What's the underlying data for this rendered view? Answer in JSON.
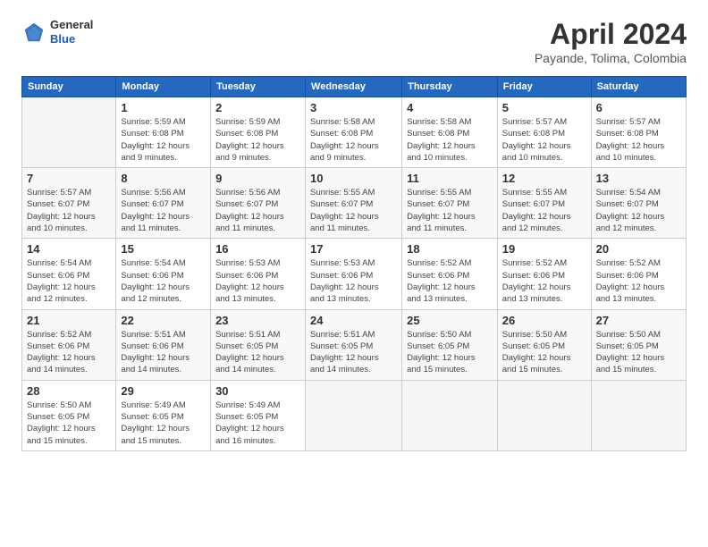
{
  "header": {
    "logo_general": "General",
    "logo_blue": "Blue",
    "month_title": "April 2024",
    "subtitle": "Payande, Tolima, Colombia"
  },
  "calendar": {
    "days_of_week": [
      "Sunday",
      "Monday",
      "Tuesday",
      "Wednesday",
      "Thursday",
      "Friday",
      "Saturday"
    ],
    "weeks": [
      [
        {
          "num": "",
          "info": ""
        },
        {
          "num": "1",
          "info": "Sunrise: 5:59 AM\nSunset: 6:08 PM\nDaylight: 12 hours\nand 9 minutes."
        },
        {
          "num": "2",
          "info": "Sunrise: 5:59 AM\nSunset: 6:08 PM\nDaylight: 12 hours\nand 9 minutes."
        },
        {
          "num": "3",
          "info": "Sunrise: 5:58 AM\nSunset: 6:08 PM\nDaylight: 12 hours\nand 9 minutes."
        },
        {
          "num": "4",
          "info": "Sunrise: 5:58 AM\nSunset: 6:08 PM\nDaylight: 12 hours\nand 10 minutes."
        },
        {
          "num": "5",
          "info": "Sunrise: 5:57 AM\nSunset: 6:08 PM\nDaylight: 12 hours\nand 10 minutes."
        },
        {
          "num": "6",
          "info": "Sunrise: 5:57 AM\nSunset: 6:08 PM\nDaylight: 12 hours\nand 10 minutes."
        }
      ],
      [
        {
          "num": "7",
          "info": "Sunrise: 5:57 AM\nSunset: 6:07 PM\nDaylight: 12 hours\nand 10 minutes."
        },
        {
          "num": "8",
          "info": "Sunrise: 5:56 AM\nSunset: 6:07 PM\nDaylight: 12 hours\nand 11 minutes."
        },
        {
          "num": "9",
          "info": "Sunrise: 5:56 AM\nSunset: 6:07 PM\nDaylight: 12 hours\nand 11 minutes."
        },
        {
          "num": "10",
          "info": "Sunrise: 5:55 AM\nSunset: 6:07 PM\nDaylight: 12 hours\nand 11 minutes."
        },
        {
          "num": "11",
          "info": "Sunrise: 5:55 AM\nSunset: 6:07 PM\nDaylight: 12 hours\nand 11 minutes."
        },
        {
          "num": "12",
          "info": "Sunrise: 5:55 AM\nSunset: 6:07 PM\nDaylight: 12 hours\nand 12 minutes."
        },
        {
          "num": "13",
          "info": "Sunrise: 5:54 AM\nSunset: 6:07 PM\nDaylight: 12 hours\nand 12 minutes."
        }
      ],
      [
        {
          "num": "14",
          "info": "Sunrise: 5:54 AM\nSunset: 6:06 PM\nDaylight: 12 hours\nand 12 minutes."
        },
        {
          "num": "15",
          "info": "Sunrise: 5:54 AM\nSunset: 6:06 PM\nDaylight: 12 hours\nand 12 minutes."
        },
        {
          "num": "16",
          "info": "Sunrise: 5:53 AM\nSunset: 6:06 PM\nDaylight: 12 hours\nand 13 minutes."
        },
        {
          "num": "17",
          "info": "Sunrise: 5:53 AM\nSunset: 6:06 PM\nDaylight: 12 hours\nand 13 minutes."
        },
        {
          "num": "18",
          "info": "Sunrise: 5:52 AM\nSunset: 6:06 PM\nDaylight: 12 hours\nand 13 minutes."
        },
        {
          "num": "19",
          "info": "Sunrise: 5:52 AM\nSunset: 6:06 PM\nDaylight: 12 hours\nand 13 minutes."
        },
        {
          "num": "20",
          "info": "Sunrise: 5:52 AM\nSunset: 6:06 PM\nDaylight: 12 hours\nand 13 minutes."
        }
      ],
      [
        {
          "num": "21",
          "info": "Sunrise: 5:52 AM\nSunset: 6:06 PM\nDaylight: 12 hours\nand 14 minutes."
        },
        {
          "num": "22",
          "info": "Sunrise: 5:51 AM\nSunset: 6:06 PM\nDaylight: 12 hours\nand 14 minutes."
        },
        {
          "num": "23",
          "info": "Sunrise: 5:51 AM\nSunset: 6:05 PM\nDaylight: 12 hours\nand 14 minutes."
        },
        {
          "num": "24",
          "info": "Sunrise: 5:51 AM\nSunset: 6:05 PM\nDaylight: 12 hours\nand 14 minutes."
        },
        {
          "num": "25",
          "info": "Sunrise: 5:50 AM\nSunset: 6:05 PM\nDaylight: 12 hours\nand 15 minutes."
        },
        {
          "num": "26",
          "info": "Sunrise: 5:50 AM\nSunset: 6:05 PM\nDaylight: 12 hours\nand 15 minutes."
        },
        {
          "num": "27",
          "info": "Sunrise: 5:50 AM\nSunset: 6:05 PM\nDaylight: 12 hours\nand 15 minutes."
        }
      ],
      [
        {
          "num": "28",
          "info": "Sunrise: 5:50 AM\nSunset: 6:05 PM\nDaylight: 12 hours\nand 15 minutes."
        },
        {
          "num": "29",
          "info": "Sunrise: 5:49 AM\nSunset: 6:05 PM\nDaylight: 12 hours\nand 15 minutes."
        },
        {
          "num": "30",
          "info": "Sunrise: 5:49 AM\nSunset: 6:05 PM\nDaylight: 12 hours\nand 16 minutes."
        },
        {
          "num": "",
          "info": ""
        },
        {
          "num": "",
          "info": ""
        },
        {
          "num": "",
          "info": ""
        },
        {
          "num": "",
          "info": ""
        }
      ]
    ]
  }
}
